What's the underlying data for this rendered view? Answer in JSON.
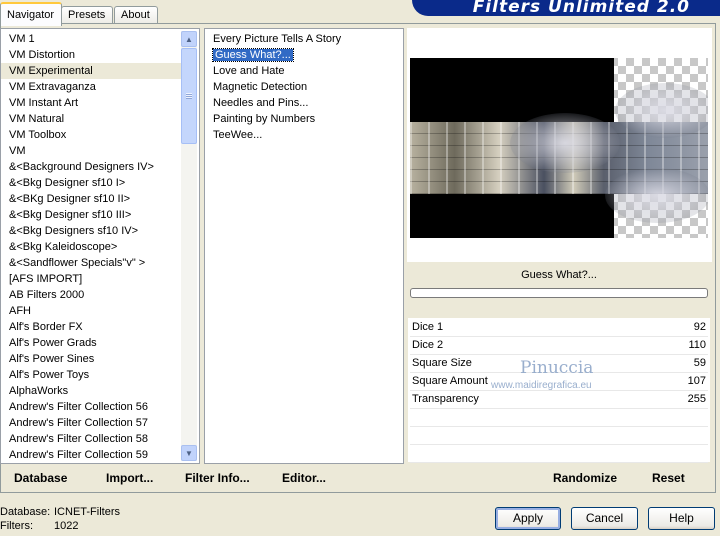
{
  "tabs": [
    {
      "label": "Navigator"
    },
    {
      "label": "Presets"
    },
    {
      "label": "About"
    }
  ],
  "banner": {
    "title": "Filters Unlimited 2.0"
  },
  "categories": [
    "VM 1",
    "VM Distortion",
    "VM Experimental",
    "VM Extravaganza",
    "VM Instant Art",
    "VM Natural",
    "VM Toolbox",
    "VM",
    "&<Background Designers IV>",
    "&<Bkg Designer sf10 I>",
    "&<BKg Designer sf10 II>",
    "&<Bkg Designer sf10 III>",
    "&<Bkg Designers sf10 IV>",
    "&<Bkg Kaleidoscope>",
    "&<Sandflower Specials\"v\" >",
    "[AFS IMPORT]",
    "AB Filters 2000",
    "AFH",
    "Alf's Border FX",
    "Alf's Power Grads",
    "Alf's Power Sines",
    "Alf's Power Toys",
    "AlphaWorks",
    "Andrew's Filter Collection 56",
    "Andrew's Filter Collection 57",
    "Andrew's Filter Collection 58",
    "Andrew's Filter Collection 59"
  ],
  "filters": [
    "Every Picture Tells A Story",
    "Guess  What?...",
    "Love and Hate",
    "Magnetic Detection",
    "Needles and Pins...",
    "Painting by Numbers",
    "TeeWee..."
  ],
  "left_actions": {
    "database": "Database",
    "import": "Import...",
    "filter_info": "Filter Info...",
    "editor": "Editor..."
  },
  "filter_name": "Guess  What?...",
  "params": [
    {
      "label": "Dice 1",
      "value": "92"
    },
    {
      "label": "Dice 2",
      "value": "110"
    },
    {
      "label": "Square Size",
      "value": "59"
    },
    {
      "label": "Square Amount",
      "value": "107"
    },
    {
      "label": "Transparency",
      "value": "255"
    }
  ],
  "watermark": {
    "name": "Pinuccia",
    "url": "www.maidiregrafica.eu"
  },
  "right_actions": {
    "randomize": "Randomize",
    "reset": "Reset"
  },
  "status": {
    "db_label": "Database:",
    "db_value": "ICNET-Filters",
    "filters_label": "Filters:",
    "filters_value": "1022"
  },
  "buttons": {
    "apply": "Apply",
    "cancel": "Cancel",
    "help": "Help"
  }
}
